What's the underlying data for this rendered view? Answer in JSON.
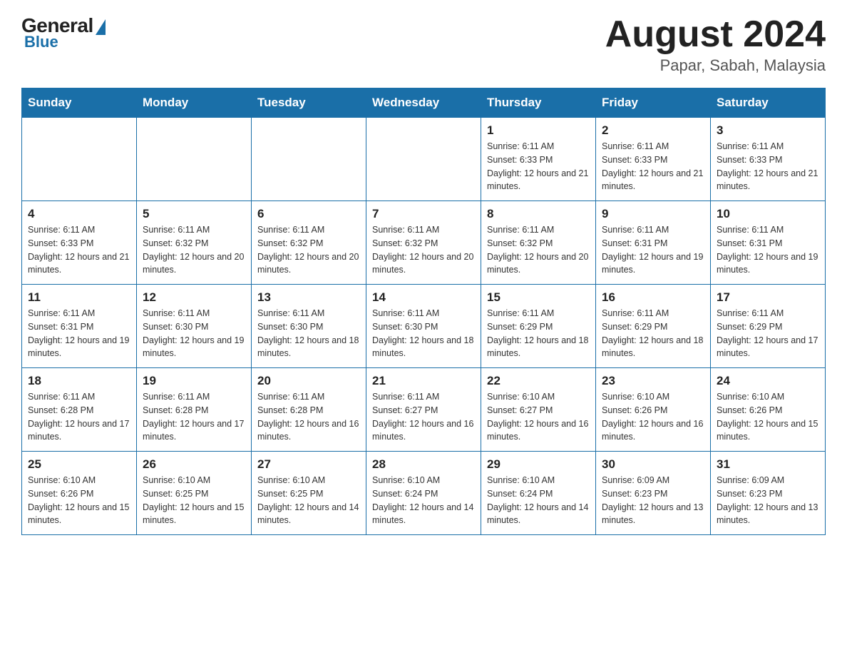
{
  "header": {
    "logo_general": "General",
    "logo_blue": "Blue",
    "title": "August 2024",
    "subtitle": "Papar, Sabah, Malaysia"
  },
  "weekdays": [
    "Sunday",
    "Monday",
    "Tuesday",
    "Wednesday",
    "Thursday",
    "Friday",
    "Saturday"
  ],
  "weeks": [
    [
      {
        "day": "",
        "info": ""
      },
      {
        "day": "",
        "info": ""
      },
      {
        "day": "",
        "info": ""
      },
      {
        "day": "",
        "info": ""
      },
      {
        "day": "1",
        "info": "Sunrise: 6:11 AM\nSunset: 6:33 PM\nDaylight: 12 hours and 21 minutes."
      },
      {
        "day": "2",
        "info": "Sunrise: 6:11 AM\nSunset: 6:33 PM\nDaylight: 12 hours and 21 minutes."
      },
      {
        "day": "3",
        "info": "Sunrise: 6:11 AM\nSunset: 6:33 PM\nDaylight: 12 hours and 21 minutes."
      }
    ],
    [
      {
        "day": "4",
        "info": "Sunrise: 6:11 AM\nSunset: 6:33 PM\nDaylight: 12 hours and 21 minutes."
      },
      {
        "day": "5",
        "info": "Sunrise: 6:11 AM\nSunset: 6:32 PM\nDaylight: 12 hours and 20 minutes."
      },
      {
        "day": "6",
        "info": "Sunrise: 6:11 AM\nSunset: 6:32 PM\nDaylight: 12 hours and 20 minutes."
      },
      {
        "day": "7",
        "info": "Sunrise: 6:11 AM\nSunset: 6:32 PM\nDaylight: 12 hours and 20 minutes."
      },
      {
        "day": "8",
        "info": "Sunrise: 6:11 AM\nSunset: 6:32 PM\nDaylight: 12 hours and 20 minutes."
      },
      {
        "day": "9",
        "info": "Sunrise: 6:11 AM\nSunset: 6:31 PM\nDaylight: 12 hours and 19 minutes."
      },
      {
        "day": "10",
        "info": "Sunrise: 6:11 AM\nSunset: 6:31 PM\nDaylight: 12 hours and 19 minutes."
      }
    ],
    [
      {
        "day": "11",
        "info": "Sunrise: 6:11 AM\nSunset: 6:31 PM\nDaylight: 12 hours and 19 minutes."
      },
      {
        "day": "12",
        "info": "Sunrise: 6:11 AM\nSunset: 6:30 PM\nDaylight: 12 hours and 19 minutes."
      },
      {
        "day": "13",
        "info": "Sunrise: 6:11 AM\nSunset: 6:30 PM\nDaylight: 12 hours and 18 minutes."
      },
      {
        "day": "14",
        "info": "Sunrise: 6:11 AM\nSunset: 6:30 PM\nDaylight: 12 hours and 18 minutes."
      },
      {
        "day": "15",
        "info": "Sunrise: 6:11 AM\nSunset: 6:29 PM\nDaylight: 12 hours and 18 minutes."
      },
      {
        "day": "16",
        "info": "Sunrise: 6:11 AM\nSunset: 6:29 PM\nDaylight: 12 hours and 18 minutes."
      },
      {
        "day": "17",
        "info": "Sunrise: 6:11 AM\nSunset: 6:29 PM\nDaylight: 12 hours and 17 minutes."
      }
    ],
    [
      {
        "day": "18",
        "info": "Sunrise: 6:11 AM\nSunset: 6:28 PM\nDaylight: 12 hours and 17 minutes."
      },
      {
        "day": "19",
        "info": "Sunrise: 6:11 AM\nSunset: 6:28 PM\nDaylight: 12 hours and 17 minutes."
      },
      {
        "day": "20",
        "info": "Sunrise: 6:11 AM\nSunset: 6:28 PM\nDaylight: 12 hours and 16 minutes."
      },
      {
        "day": "21",
        "info": "Sunrise: 6:11 AM\nSunset: 6:27 PM\nDaylight: 12 hours and 16 minutes."
      },
      {
        "day": "22",
        "info": "Sunrise: 6:10 AM\nSunset: 6:27 PM\nDaylight: 12 hours and 16 minutes."
      },
      {
        "day": "23",
        "info": "Sunrise: 6:10 AM\nSunset: 6:26 PM\nDaylight: 12 hours and 16 minutes."
      },
      {
        "day": "24",
        "info": "Sunrise: 6:10 AM\nSunset: 6:26 PM\nDaylight: 12 hours and 15 minutes."
      }
    ],
    [
      {
        "day": "25",
        "info": "Sunrise: 6:10 AM\nSunset: 6:26 PM\nDaylight: 12 hours and 15 minutes."
      },
      {
        "day": "26",
        "info": "Sunrise: 6:10 AM\nSunset: 6:25 PM\nDaylight: 12 hours and 15 minutes."
      },
      {
        "day": "27",
        "info": "Sunrise: 6:10 AM\nSunset: 6:25 PM\nDaylight: 12 hours and 14 minutes."
      },
      {
        "day": "28",
        "info": "Sunrise: 6:10 AM\nSunset: 6:24 PM\nDaylight: 12 hours and 14 minutes."
      },
      {
        "day": "29",
        "info": "Sunrise: 6:10 AM\nSunset: 6:24 PM\nDaylight: 12 hours and 14 minutes."
      },
      {
        "day": "30",
        "info": "Sunrise: 6:09 AM\nSunset: 6:23 PM\nDaylight: 12 hours and 13 minutes."
      },
      {
        "day": "31",
        "info": "Sunrise: 6:09 AM\nSunset: 6:23 PM\nDaylight: 12 hours and 13 minutes."
      }
    ]
  ]
}
